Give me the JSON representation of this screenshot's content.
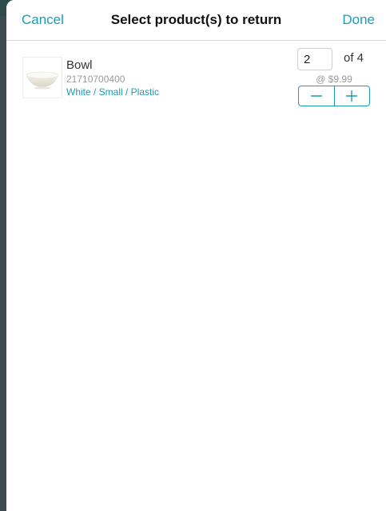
{
  "nav": {
    "cancel_label": "Cancel",
    "title": "Select product(s) to return",
    "done_label": "Done"
  },
  "product": {
    "name": "Bowl",
    "sku": "21710700400",
    "variant": "White / Small / Plastic",
    "image_icon": "bowl-image",
    "quantity_value": "2",
    "quantity_total_label": "of 4",
    "unit_price_label": "@  $9.99",
    "decrement_icon": "minus-icon",
    "increment_icon": "plus-icon"
  },
  "colors": {
    "accent": "#1c9cb4",
    "text_primary": "#333333",
    "text_secondary": "#9a9a9a",
    "backdrop": "#3c4a52"
  }
}
